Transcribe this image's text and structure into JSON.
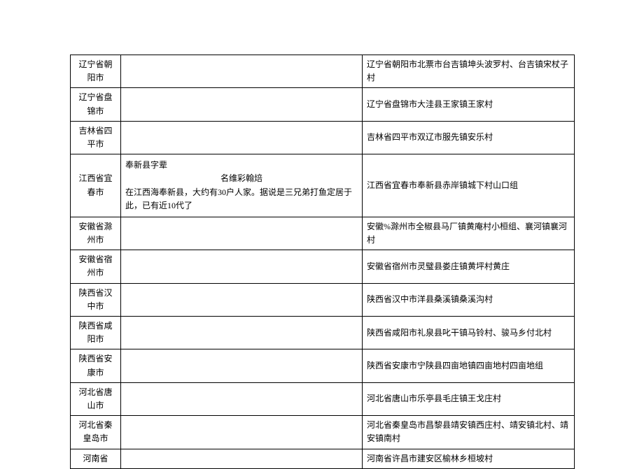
{
  "rows": [
    {
      "region": "辽宁省朝阳市",
      "middle": "",
      "detail": "辽宁省朝阳市北票市台吉镇坤头波罗村、台吉镇宋杖子村"
    },
    {
      "region": "辽宁省盘锦市",
      "middle": "",
      "detail": "辽宁省盘锦市大洼县王家镇王家村"
    },
    {
      "region": "吉林省四平市",
      "middle": "",
      "detail": "吉林省四平市双辽市服先镇安乐村"
    },
    {
      "region": "江西省宜春市",
      "middle_line1": "奉新县字辈",
      "middle_line2": "名维彩翰焙",
      "middle_line3": "在江西海奉新县，大约有30户人家。据说是三兄弟打鱼定居于此，已有近10代了",
      "detail": "江西省宜春市奉新县赤岸镇城下村山口组"
    },
    {
      "region": "安徽省滁州市",
      "middle": "",
      "detail": "安徽%滁州市全椒县马厂镇黄庵村小桓组、襄河镇襄河村"
    },
    {
      "region": "安徽省宿州市",
      "middle": "",
      "detail": "安徽省宿州市灵璧县娄庄镇黄坪村黄庄"
    },
    {
      "region": "陕西省汉中市",
      "middle": "",
      "detail": "陕西省汉中市洋县桑溪镇桑溪沟村"
    },
    {
      "region": "陕西省咸阳市",
      "middle": "",
      "detail": "陕西省咸阳市礼泉县叱干镇马铃村、骏马乡付北村"
    },
    {
      "region": "陕西省安康市",
      "middle": "",
      "detail": "陕西省安康市宁陕县四亩地镇四亩地村四亩地组"
    },
    {
      "region": "河北省唐山市",
      "middle": "",
      "detail": "河北省唐山市乐亭县毛庄镇王戈庄村"
    },
    {
      "region": "河北省秦皇岛市",
      "middle": "",
      "detail": "河北省秦皇岛市昌黎县靖安镇西庄村、靖安镇北村、靖安镇南村"
    },
    {
      "region": "河南省",
      "middle": "",
      "detail": "河南省许昌市建安区榆林乡桓坡村"
    }
  ]
}
